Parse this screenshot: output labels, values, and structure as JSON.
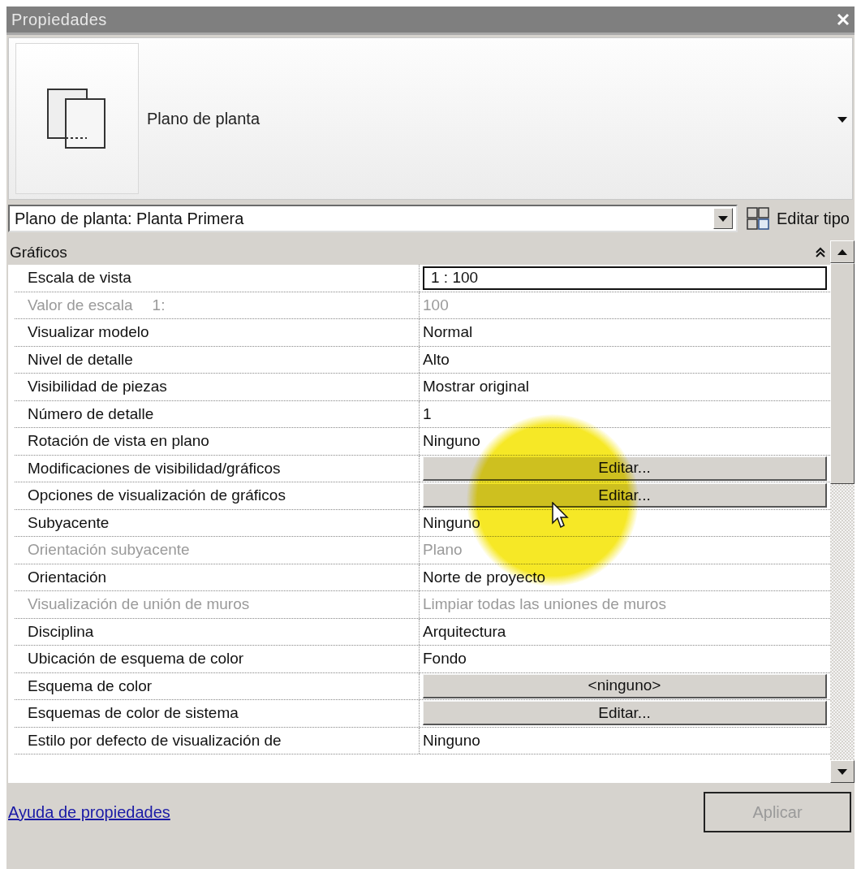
{
  "window": {
    "title": "Propiedades"
  },
  "type_header": {
    "name": "Plano de planta"
  },
  "type_selector": {
    "value": "Plano de planta: Planta Primera"
  },
  "edit_type_button": {
    "label": "Editar tipo"
  },
  "groups": [
    {
      "label": "Gráficos",
      "expanded": true,
      "rows": [
        {
          "label": "Escala de vista",
          "value": "1 : 100",
          "kind": "input",
          "disabled": false
        },
        {
          "label": "Valor de escala",
          "unit": "1:",
          "value": "100",
          "kind": "text",
          "disabled": true
        },
        {
          "label": "Visualizar modelo",
          "value": "Normal",
          "kind": "text",
          "disabled": false
        },
        {
          "label": "Nivel de detalle",
          "value": "Alto",
          "kind": "text",
          "disabled": false
        },
        {
          "label": "Visibilidad de piezas",
          "value": "Mostrar original",
          "kind": "text",
          "disabled": false
        },
        {
          "label": "Número de detalle",
          "value": "1",
          "kind": "text",
          "disabled": false
        },
        {
          "label": "Rotación de vista en plano",
          "value": "Ninguno",
          "kind": "text",
          "disabled": false
        },
        {
          "label": "Modificaciones de visibilidad/gráficos",
          "value": "Editar...",
          "kind": "button",
          "disabled": false
        },
        {
          "label": "Opciones de visualización de gráficos",
          "value": "Editar...",
          "kind": "button",
          "disabled": false
        },
        {
          "label": "Subyacente",
          "value": "Ninguno",
          "kind": "text",
          "disabled": false
        },
        {
          "label": "Orientación subyacente",
          "value": "Plano",
          "kind": "text",
          "disabled": true
        },
        {
          "label": "Orientación",
          "value": "Norte de proyecto",
          "kind": "text",
          "disabled": false
        },
        {
          "label": "Visualización de unión de muros",
          "value": "Limpiar todas las uniones de muros",
          "kind": "text",
          "disabled": true
        },
        {
          "label": "Disciplina",
          "value": "Arquitectura",
          "kind": "text",
          "disabled": false
        },
        {
          "label": "Ubicación de esquema de color",
          "value": "Fondo",
          "kind": "text",
          "disabled": false
        },
        {
          "label": "Esquema de color",
          "value": "<ninguno>",
          "kind": "button",
          "disabled": false
        },
        {
          "label": "Esquemas de color de sistema",
          "value": "Editar...",
          "kind": "button",
          "disabled": false
        },
        {
          "label": "Estilo por defecto de visualización de",
          "value": "Ninguno",
          "kind": "text",
          "disabled": false
        }
      ]
    }
  ],
  "help_link": {
    "label": "Ayuda de propiedades"
  },
  "apply_button": {
    "label": "Aplicar",
    "disabled": true
  }
}
